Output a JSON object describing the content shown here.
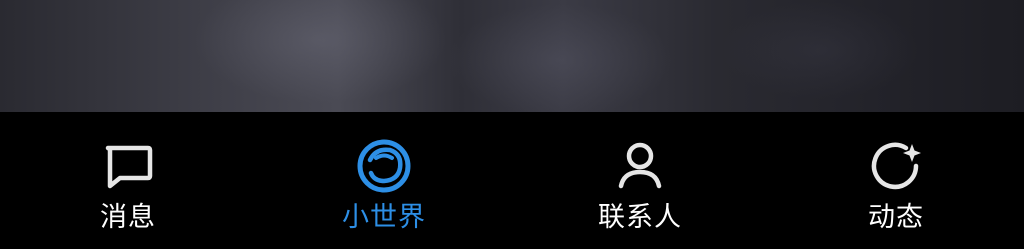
{
  "tabbar": {
    "active_index": 1,
    "active_color": "#2d8fe6",
    "inactive_icon_color": "#e6e6e6",
    "items": [
      {
        "label": "消息",
        "icon": "message-bubble-icon"
      },
      {
        "label": "小世界",
        "icon": "small-world-icon"
      },
      {
        "label": "联系人",
        "icon": "contact-person-icon"
      },
      {
        "label": "动态",
        "icon": "dynamic-refresh-star-icon"
      }
    ]
  }
}
